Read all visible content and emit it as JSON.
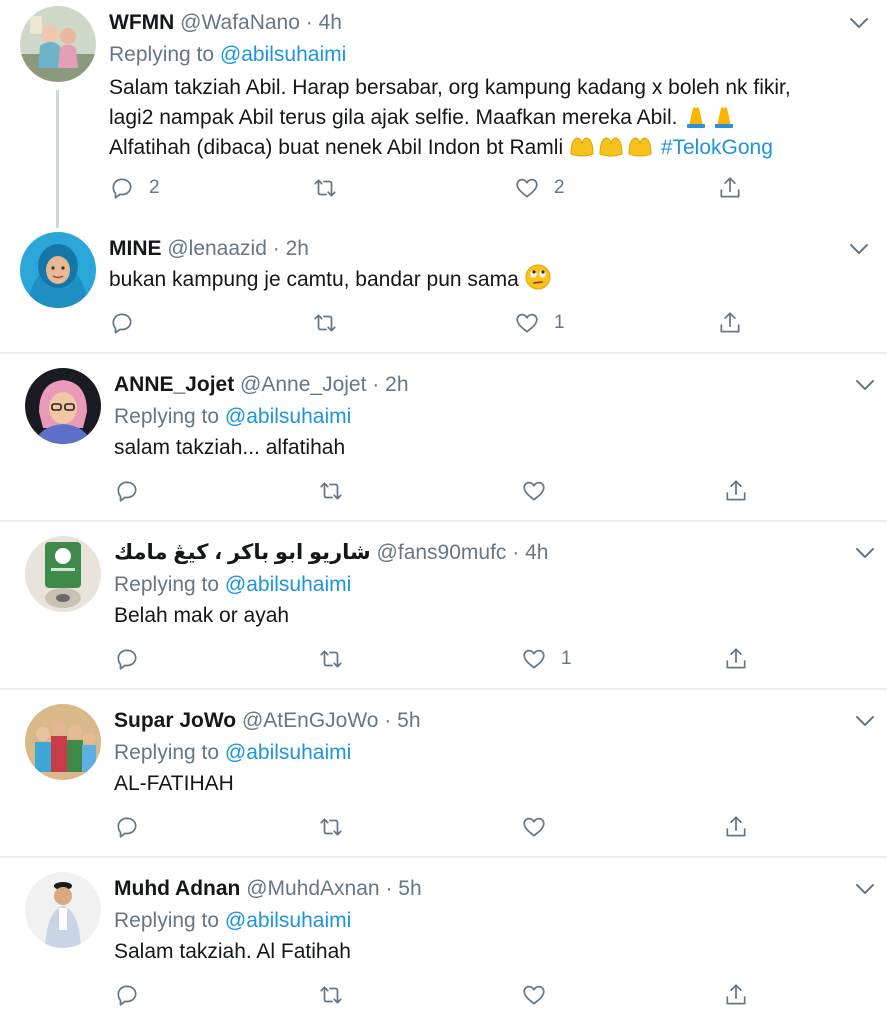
{
  "tweets": [
    {
      "name": "WFMN",
      "handle": "@WafaNano",
      "dot": "·",
      "time": "4h",
      "replying_prefix": "Replying to",
      "replying_to": "@abilsuhaimi",
      "lines": [
        "Salam takziah Abil. Harap bersabar, org kampung kadang x boleh nk fikir,",
        "lagi2 nampak Abil terus gila ajak selfie. Maafkan mereka Abil.",
        "Alfatihah (dibaca) buat nenek Abil Indon bt Ramli"
      ],
      "hashtag": "#TelokGong",
      "reply_count": "2",
      "retweet_count": "",
      "like_count": "2"
    },
    {
      "name": "MINE",
      "handle": "@lenaazid",
      "dot": "·",
      "time": "2h",
      "lines": [
        "bukan kampung je camtu, bandar pun sama"
      ],
      "reply_count": "",
      "retweet_count": "",
      "like_count": "1"
    },
    {
      "name": "ANNE_Jojet",
      "handle": "@Anne_Jojet",
      "dot": "·",
      "time": "2h",
      "replying_prefix": "Replying to",
      "replying_to": "@abilsuhaimi",
      "lines": [
        "salam takziah... alfatihah"
      ],
      "reply_count": "",
      "retweet_count": "",
      "like_count": ""
    },
    {
      "name": "شاريو ابو باكر ، كيڠ مامك",
      "handle": "@fans90mufc",
      "dot": "·",
      "time": "4h",
      "replying_prefix": "Replying to",
      "replying_to": "@abilsuhaimi",
      "lines": [
        "Belah mak or ayah"
      ],
      "reply_count": "",
      "retweet_count": "",
      "like_count": "1"
    },
    {
      "name": "Supar JoWo",
      "handle": "@AtEnGJoWo",
      "dot": "·",
      "time": "5h",
      "replying_prefix": "Replying to",
      "replying_to": "@abilsuhaimi",
      "lines": [
        "AL-FATIHAH"
      ],
      "reply_count": "",
      "retweet_count": "",
      "like_count": ""
    },
    {
      "name": "Muhd Adnan",
      "handle": "@MuhdAxnan",
      "dot": "·",
      "time": "5h",
      "replying_prefix": "Replying to",
      "replying_to": "@abilsuhaimi",
      "lines": [
        "Salam takziah. Al Fatihah"
      ],
      "reply_count": "",
      "retweet_count": "",
      "like_count": ""
    }
  ],
  "icons": {
    "reply": "reply-icon",
    "retweet": "retweet-icon",
    "like": "like-icon",
    "share": "share-icon",
    "more": "chevron-down-icon"
  },
  "colors": {
    "link": "#1b95e0",
    "secondary_text": "#657786",
    "icon": "#657786",
    "separator": "#e6ecf0"
  }
}
